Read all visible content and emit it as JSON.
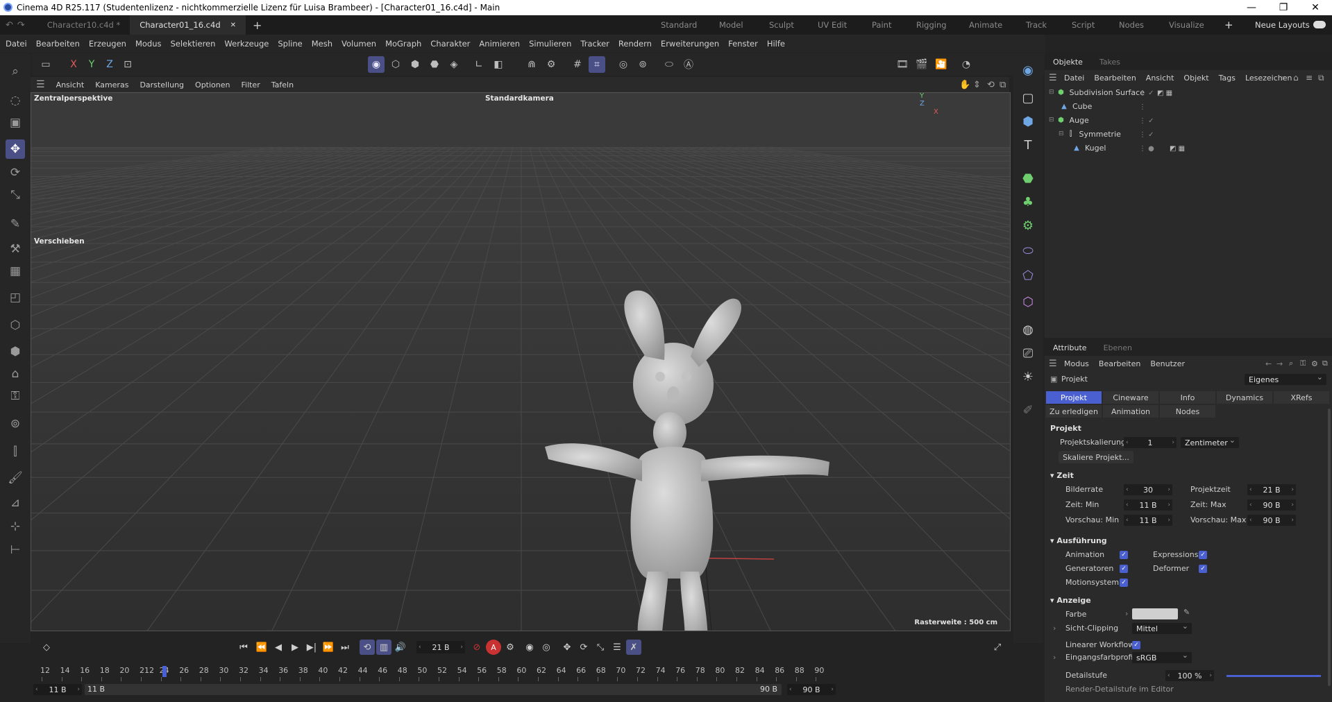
{
  "window": {
    "title": "Cinema 4D R25.117 (Studentenlizenz - nichtkommerzielle Lizenz für Luisa Brambeer) - [Character01_16.c4d] - Main"
  },
  "tabs": [
    {
      "label": "Character10.c4d *"
    },
    {
      "label": "Character01_16.c4d"
    }
  ],
  "layouts": [
    "Standard",
    "Model",
    "Sculpt",
    "UV Edit",
    "Paint",
    "Rigging",
    "Animate",
    "Track",
    "Script",
    "Nodes",
    "Visualize"
  ],
  "layout_button": "Neue Layouts",
  "menu": [
    "Datei",
    "Bearbeiten",
    "Erzeugen",
    "Modus",
    "Selektieren",
    "Werkzeuge",
    "Spline",
    "Mesh",
    "Volumen",
    "MoGraph",
    "Charakter",
    "Animieren",
    "Simulieren",
    "Tracker",
    "Rendern",
    "Erweiterungen",
    "Fenster",
    "Hilfe"
  ],
  "axes": {
    "x": "X",
    "y": "Y",
    "z": "Z"
  },
  "viewport": {
    "menu": [
      "Ansicht",
      "Kameras",
      "Darstellung",
      "Optionen",
      "Filter",
      "Tafeln"
    ],
    "name": "Zentralperspektive",
    "camera": "Standardkamera",
    "tool_label": "Verschieben",
    "grid_info": "Rasterweite : 500 cm",
    "axis_y": "Y",
    "axis_z": "Z",
    "axis_x": "X"
  },
  "objects": {
    "tabs": [
      "Objekte",
      "Takes"
    ],
    "menu": [
      "Datei",
      "Bearbeiten",
      "Ansicht",
      "Objekt",
      "Tags",
      "Lesezeichen"
    ],
    "tree": [
      {
        "name": "Subdivision Surface",
        "icon": "subdivision-icon"
      },
      {
        "name": "Cube",
        "icon": "polygon-icon"
      },
      {
        "name": "Auge",
        "icon": "subdivision-icon"
      },
      {
        "name": "Symmetrie",
        "icon": "symmetry-icon"
      },
      {
        "name": "Kugel",
        "icon": "polygon-icon"
      }
    ]
  },
  "attributes": {
    "tabs": [
      "Attribute",
      "Ebenen"
    ],
    "menu": [
      "Modus",
      "Bearbeiten",
      "Benutzer"
    ],
    "object": "Projekt",
    "mode": "Eigenes",
    "subtabs": [
      "Projekt",
      "Cineware",
      "Info",
      "Dynamics",
      "XRefs"
    ],
    "subtabs2": [
      "Zu erledigen",
      "Animation",
      "Nodes"
    ],
    "section_title": "Projekt",
    "projektskalierung": {
      "label": "Projektskalierung",
      "value": "1",
      "unit": "Zentimeter"
    },
    "skaliere_button": "Skaliere Projekt...",
    "zeit": {
      "title": "Zeit",
      "bilderrate": {
        "label": "Bilderrate",
        "value": "30"
      },
      "projektzeit": {
        "label": "Projektzeit",
        "value": "21 B"
      },
      "zeit_min": {
        "label": "Zeit: Min",
        "value": "11 B"
      },
      "zeit_max": {
        "label": "Zeit: Max",
        "value": "90 B"
      },
      "vorschau_min": {
        "label": "Vorschau: Min",
        "value": "11 B"
      },
      "vorschau_max": {
        "label": "Vorschau: Max",
        "value": "90 B"
      }
    },
    "ausfuehrung": {
      "title": "Ausführung",
      "animation": "Animation",
      "expressions": "Expressions",
      "generatoren": "Generatoren",
      "deformer": "Deformer",
      "motionsystem": "Motionsystem"
    },
    "anzeige": {
      "title": "Anzeige",
      "farbe": "Farbe",
      "sicht_clipping": "Sicht-Clipping",
      "sicht_value": "Mittel",
      "linear": "Linearer Workflow",
      "eingang": "Eingangsfarbprofil",
      "eingang_value": "sRGB",
      "detailstufe": "Detailstufe",
      "detail_value": "100 %",
      "render_detail": "Render-Detailstufe im Editor"
    }
  },
  "timeline": {
    "frame": "21 B",
    "ticks": [
      "12",
      "14",
      "16",
      "18",
      "20",
      "212",
      "24",
      "26",
      "28",
      "30",
      "32",
      "34",
      "36",
      "38",
      "40",
      "42",
      "44",
      "46",
      "48",
      "50",
      "52",
      "54",
      "56",
      "58",
      "60",
      "62",
      "64",
      "66",
      "68",
      "70",
      "72",
      "74",
      "76",
      "78",
      "80",
      "82",
      "84",
      "86",
      "88",
      "90"
    ],
    "start": "11 B",
    "start2": "11 B",
    "end": "90 B",
    "end2": "90 B"
  },
  "colors": {
    "accent": "#4a5fd0",
    "record": "#c83232"
  }
}
